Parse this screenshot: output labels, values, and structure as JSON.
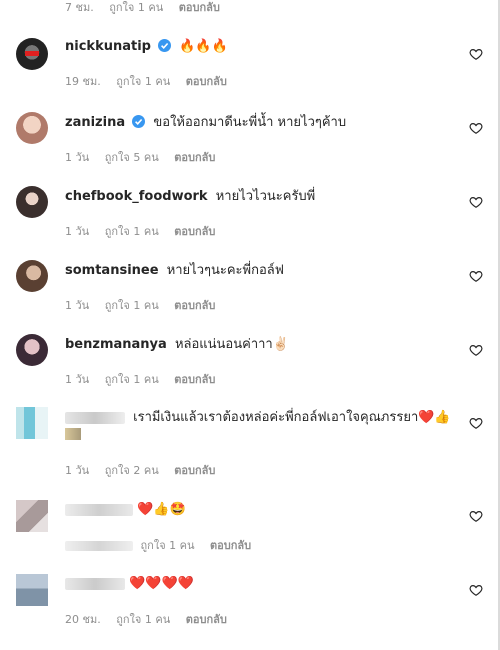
{
  "top_meta": {
    "time": "7 ชม.",
    "likes": "ถูกใจ 1 คน",
    "reply": "ตอบกลับ"
  },
  "comments": [
    {
      "user": "nickkunatip",
      "verified": true,
      "text": "",
      "emoji": "🔥🔥🔥",
      "time": "19 ชม.",
      "likes": "ถูกใจ 1 คน",
      "reply": "ตอบกลับ"
    },
    {
      "user": "zanizina",
      "verified": true,
      "text": "ขอให้ออกมาดีนะพี่น้ำ หายไวๆค้าบ",
      "emoji": "",
      "time": "1 วัน",
      "likes": "ถูกใจ 5 คน",
      "reply": "ตอบกลับ"
    },
    {
      "user": "chefbook_foodwork",
      "verified": false,
      "text": "หายไวไวนะครับพี่",
      "emoji": "",
      "time": "1 วัน",
      "likes": "ถูกใจ 1 คน",
      "reply": "ตอบกลับ"
    },
    {
      "user": "somtansinee",
      "verified": false,
      "text": "หายไวๆนะคะพี่กอล์ฟ",
      "emoji": "",
      "time": "1 วัน",
      "likes": "ถูกใจ 1 คน",
      "reply": "ตอบกลับ"
    },
    {
      "user": "benzmananya",
      "verified": false,
      "text": "หล่อแน่นอนค่าาา",
      "emoji": "✌🏻",
      "time": "1 วัน",
      "likes": "ถูกใจ 1 คน",
      "reply": "ตอบกลับ"
    },
    {
      "user": "",
      "verified": false,
      "text": "เรามีเงินแล้วเราต้องหล่อค่ะพี่กอล์ฟเอาใจคุณภรรยา",
      "emoji": "❤️👍",
      "time": "1 วัน",
      "likes": "ถูกใจ 2 คน",
      "reply": "ตอบกลับ"
    },
    {
      "user": "",
      "verified": false,
      "text": "",
      "emoji": "❤️👍🤩",
      "time": "",
      "likes": "ถูกใจ 1 คน",
      "reply": "ตอบกลับ"
    },
    {
      "user": "",
      "verified": false,
      "text": "",
      "emoji": "❤️❤️❤️❤️",
      "time": "20 ชม.",
      "likes": "ถูกใจ 1 คน",
      "reply": "ตอบกลับ"
    }
  ],
  "colors": {
    "meta": "#8e8e8e",
    "verified": "#3897f0",
    "text": "#262626"
  }
}
